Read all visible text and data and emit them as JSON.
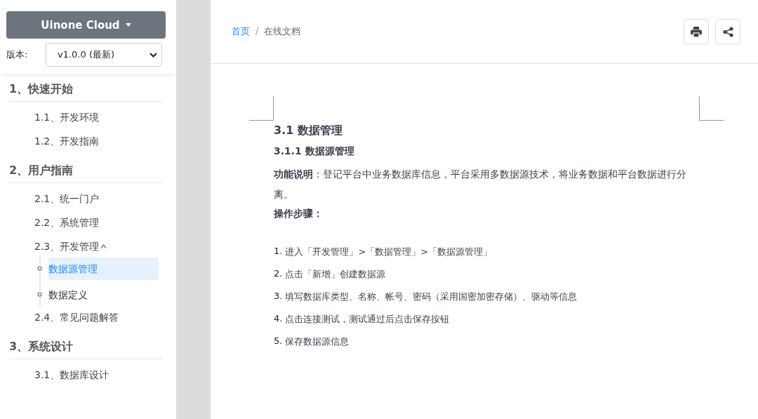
{
  "sidebar": {
    "product_button": "Uinone Cloud",
    "version_label": "版本:",
    "version_value": "v1.0.0 (最新)",
    "sections": [
      {
        "title": "1、快速开始",
        "items": [
          {
            "label": "1.1、开发环境",
            "expanded": false
          },
          {
            "label": "1.2、开发指南",
            "expanded": false
          }
        ]
      },
      {
        "title": "2、用户指南",
        "items": [
          {
            "label": "2.1、统一门户",
            "expanded": false
          },
          {
            "label": "2.2、系统管理",
            "expanded": false
          },
          {
            "label": "2.3、开发管理",
            "expanded": true,
            "children": [
              {
                "label": "数据源管理",
                "selected": true
              },
              {
                "label": "数据定义",
                "selected": false
              }
            ]
          },
          {
            "label": "2.4、常见问题解答",
            "expanded": false
          }
        ]
      },
      {
        "title": "3、系统设计",
        "items": [
          {
            "label": "3.1、数据库设计",
            "expanded": false
          }
        ]
      }
    ]
  },
  "breadcrumb": {
    "separator": "/",
    "items": [
      {
        "label": "首页",
        "link": true
      },
      {
        "label": "在线文档",
        "link": false
      }
    ]
  },
  "document": {
    "title": "3.1 数据管理",
    "subtitle": "3.1.1 数据源管理",
    "description": "**功能说明**：登记平台中业务数据库信息，平台采用多数据源技术，将业务数据和平台数据进行分离。",
    "steps_label": "操作步骤：",
    "steps": [
      {
        "num": "1.",
        "text": "进入「开发管理」>「数据管理」>「数据源管理」"
      },
      {
        "num": "2.",
        "text": "点击「新增」创建数据源"
      },
      {
        "num": "3.",
        "text": "填写数据库类型、名称、帐号、密码（采用国密加密存储）、驱动等信息"
      },
      {
        "num": "4.",
        "text": "点击连接测试，测试通过后点击保存按钮"
      },
      {
        "num": "5.",
        "text": "保存数据源信息"
      }
    ]
  }
}
